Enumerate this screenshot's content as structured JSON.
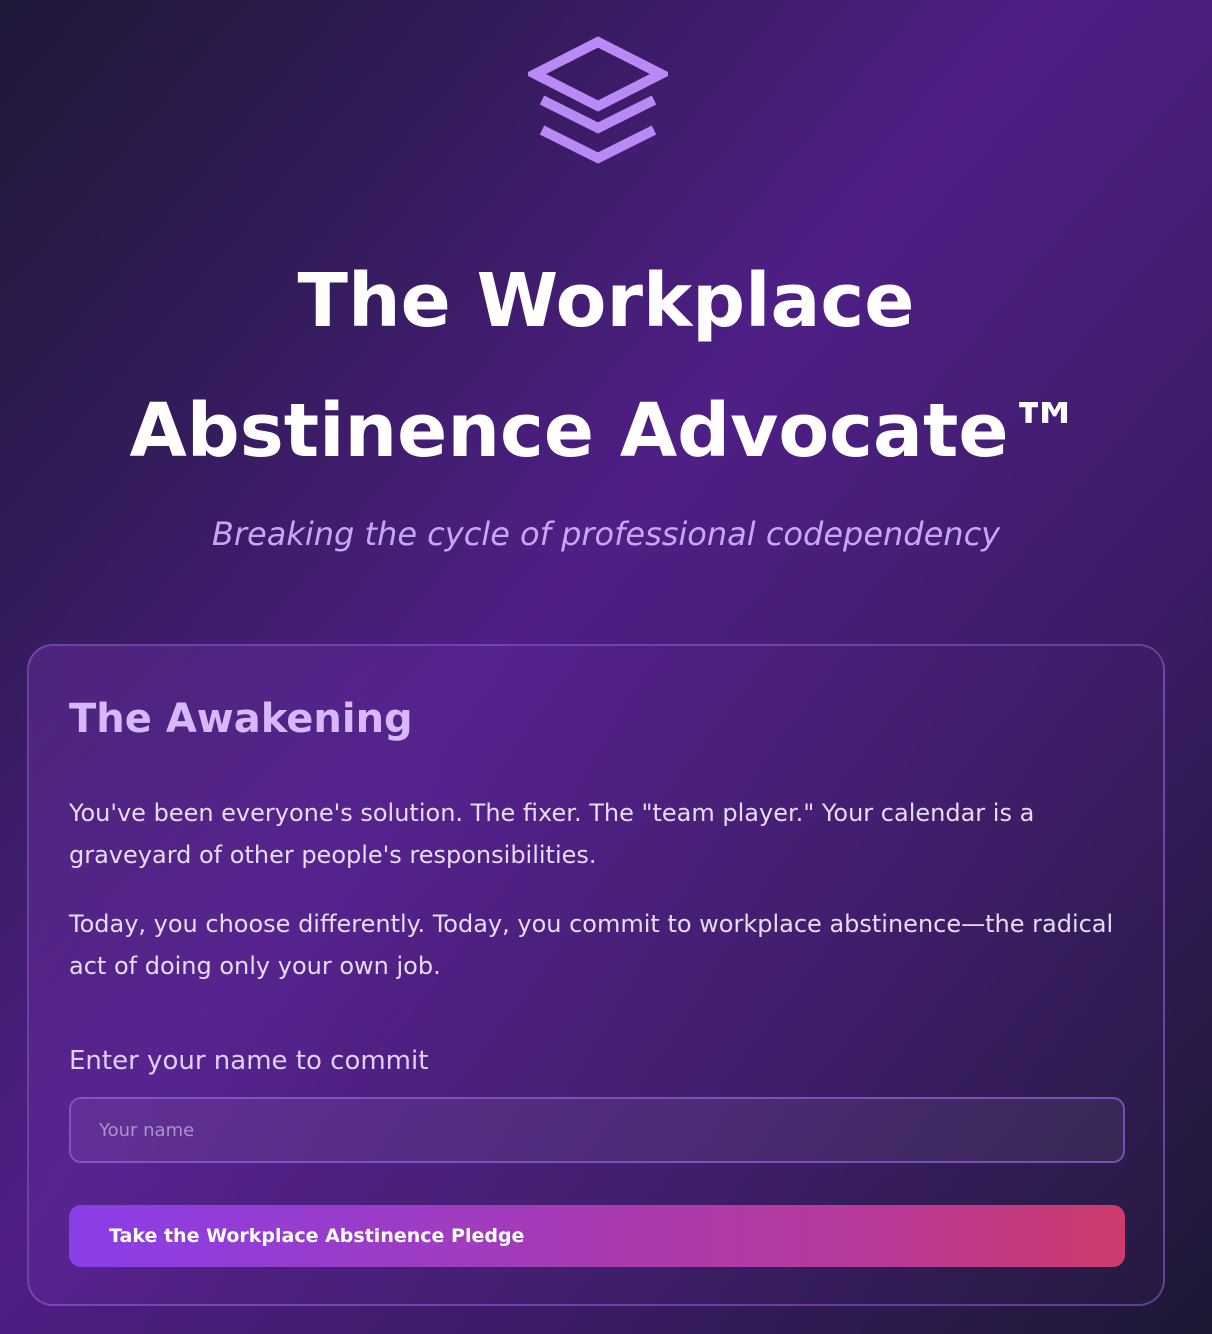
{
  "header": {
    "logo_icon": "layers-icon",
    "title_line_1": "The Workplace",
    "title_line_2": "Abstinence Advocate™",
    "tagline": "Breaking the cycle of professional codependency"
  },
  "card": {
    "title": "The Awakening",
    "paragraphs": [
      "You've been everyone's solution. The fixer. The \"team player.\" Your calendar is a graveyard of other people's responsibilities.",
      "Today, you choose differently. Today, you commit to workplace abstinence—the radical act of doing only your own job."
    ],
    "name_field": {
      "label": "Enter your name to commit",
      "placeholder": "Your name",
      "value": ""
    },
    "pledge_button_label": "Take the Workplace Abstinence Pledge"
  },
  "colors": {
    "accent": "#b98af5",
    "card_title": "#d6b8fb",
    "tagline": "#c9a6f5",
    "button_start": "#8a3ee8",
    "button_end": "#cc3b6c"
  }
}
